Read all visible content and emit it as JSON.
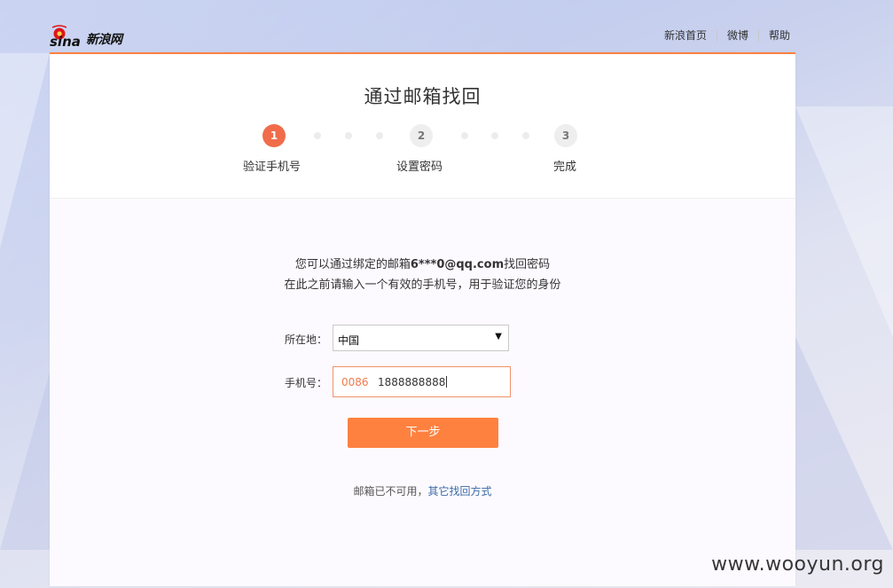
{
  "brand": {
    "logo_text": "新浪网"
  },
  "topnav": {
    "items": [
      "新浪首页",
      "微博",
      "帮助"
    ]
  },
  "page": {
    "title": "通过邮箱找回"
  },
  "steps": [
    {
      "number": "1",
      "label": "验证手机号",
      "state": "active"
    },
    {
      "number": "2",
      "label": "设置密码",
      "state": "pending"
    },
    {
      "number": "3",
      "label": "完成",
      "state": "pending"
    }
  ],
  "intro": {
    "line1_prefix": "您可以通过绑定的邮箱",
    "email": "6***0@qq.com",
    "line1_suffix": "找回密码",
    "line2": "在此之前请输入一个有效的手机号，用于验证您的身份"
  },
  "form": {
    "location_label": "所在地：",
    "location_value": "中国",
    "phone_label": "手机号：",
    "country_code": "0086",
    "phone_value": "1888888888"
  },
  "actions": {
    "next_label": "下一步"
  },
  "footer": {
    "unavailable_text": "邮箱已不可用，",
    "other_link": "其它找回方式"
  },
  "watermark": "www.wooyun.org",
  "colors": {
    "accent": "#ff8140",
    "step_active": "#f06c4a",
    "link": "#3b6aa6"
  }
}
